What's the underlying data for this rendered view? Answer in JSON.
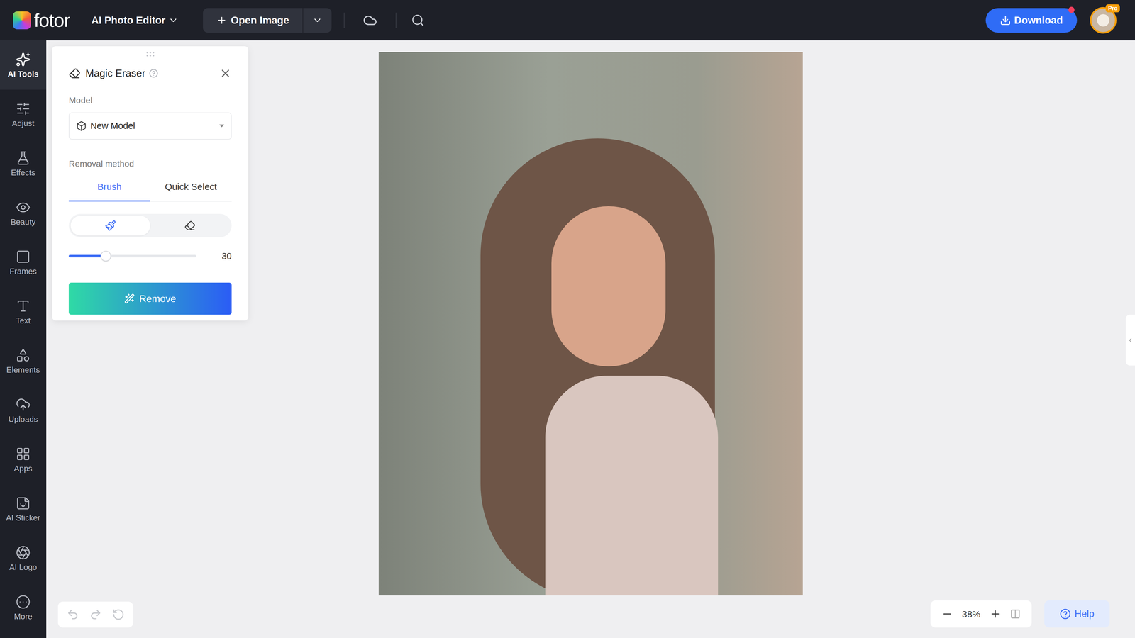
{
  "top_bar": {
    "logo": "fotor",
    "app_menu": "AI Photo Editor",
    "open_button": "Open Image",
    "download_button": "Download",
    "download_notification": true,
    "avatar_badge": "Pro"
  },
  "sidebar": {
    "items": [
      {
        "label": "AI Tools",
        "selected": true
      },
      {
        "label": "Adjust",
        "selected": false
      },
      {
        "label": "Effects",
        "selected": false
      },
      {
        "label": "Beauty",
        "selected": false
      },
      {
        "label": "Frames",
        "selected": false
      },
      {
        "label": "Text",
        "selected": false
      },
      {
        "label": "Elements",
        "selected": false
      },
      {
        "label": "Uploads",
        "selected": false
      },
      {
        "label": "Apps",
        "selected": false
      },
      {
        "label": "AI Sticker",
        "selected": false
      },
      {
        "label": "AI Logo",
        "selected": false
      },
      {
        "label": "More",
        "selected": false
      }
    ]
  },
  "panel": {
    "title": "Magic Eraser",
    "model_label": "Model",
    "model_value": "New Model",
    "removal_label": "Removal method",
    "tabs": [
      {
        "label": "Brush",
        "selected": true
      },
      {
        "label": "Quick Select",
        "selected": false
      }
    ],
    "brush_modes": [
      {
        "kind": "add",
        "selected": true
      },
      {
        "kind": "erase",
        "selected": false
      }
    ],
    "brush_size": {
      "level": 0.29,
      "reading": "30"
    },
    "remove_button": "Remove"
  },
  "history": {
    "undo_disabled": true,
    "redo_disabled": true,
    "reset_disabled": true
  },
  "zoom": {
    "value": "38%"
  },
  "help": {
    "label": "Help"
  }
}
